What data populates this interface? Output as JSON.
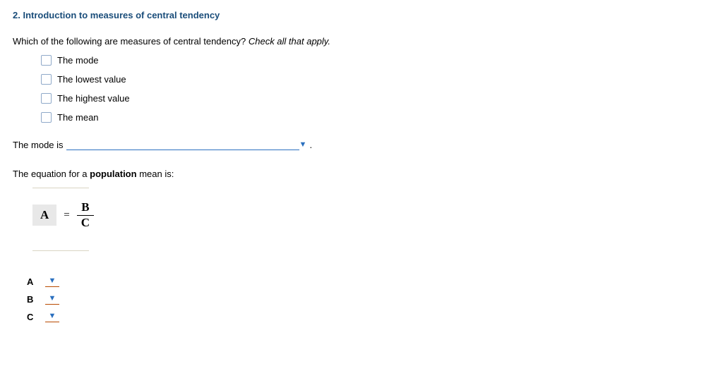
{
  "title": "2. Introduction to measures of central tendency",
  "question1": {
    "prompt": "Which of the following are measures of central tendency? ",
    "instruction": "Check all that apply.",
    "options": [
      "The mode",
      "The lowest value",
      "The highest value",
      "The mean"
    ]
  },
  "fill": {
    "lead": "The mode is",
    "trail": "."
  },
  "equation_intro": {
    "t1": "The equation for a ",
    "bold": "population",
    "t2": " mean is:"
  },
  "eq": {
    "left": "A",
    "eq": "=",
    "num": "B",
    "den": "C"
  },
  "answers": [
    "A",
    "B",
    "C"
  ]
}
